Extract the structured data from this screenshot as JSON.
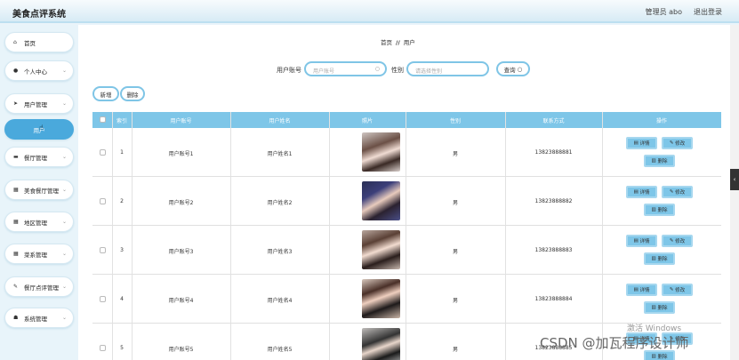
{
  "header": {
    "brand": "美食点评系统",
    "admin": "管理员 abo",
    "logout": "退出登录"
  },
  "sidebar": {
    "items": [
      {
        "label": "首页",
        "icon": "home-icon"
      },
      {
        "label": "个人中心",
        "icon": "user-icon"
      },
      {
        "label": "用户管理",
        "icon": "send-icon"
      },
      {
        "label": "用户",
        "icon": ""
      },
      {
        "label": "餐厅管理",
        "icon": "card-icon"
      },
      {
        "label": "美食餐厅管理",
        "icon": "grid-icon"
      },
      {
        "label": "地区管理",
        "icon": "grid-icon"
      },
      {
        "label": "菜系管理",
        "icon": "grid-icon"
      },
      {
        "label": "餐厅点评管理",
        "icon": "edit-icon"
      },
      {
        "label": "系统管理",
        "icon": "settings-icon"
      }
    ]
  },
  "breadcrumb": {
    "home": "首页",
    "sep": "//",
    "current": "用户"
  },
  "search": {
    "account_label": "用户账号",
    "account_placeholder": "用户账号",
    "gender_label": "性别",
    "gender_placeholder": "请选择性别",
    "query_label": "查询"
  },
  "actions": {
    "add": "新增",
    "delete": "删除"
  },
  "table": {
    "headers": [
      "索引",
      "用户账号",
      "用户姓名",
      "照片",
      "性别",
      "联系方式",
      "操作"
    ],
    "rows": [
      {
        "index": "1",
        "account": "用户账号1",
        "name": "用户姓名1",
        "gender": "男",
        "phone": "13823888881"
      },
      {
        "index": "2",
        "account": "用户账号2",
        "name": "用户姓名2",
        "gender": "男",
        "phone": "13823888882"
      },
      {
        "index": "3",
        "account": "用户账号3",
        "name": "用户姓名3",
        "gender": "男",
        "phone": "13823888883"
      },
      {
        "index": "4",
        "account": "用户账号4",
        "name": "用户姓名4",
        "gender": "男",
        "phone": "13823888884"
      },
      {
        "index": "5",
        "account": "用户账号5",
        "name": "用户姓名5",
        "gender": "男",
        "phone": "13823888885"
      }
    ],
    "row_actions": {
      "detail": "详情",
      "edit": "修改",
      "delete": "删除"
    }
  },
  "watermarks": {
    "activate": "激活 Windows",
    "csdn": "CSDN @加瓦程序设计师"
  }
}
